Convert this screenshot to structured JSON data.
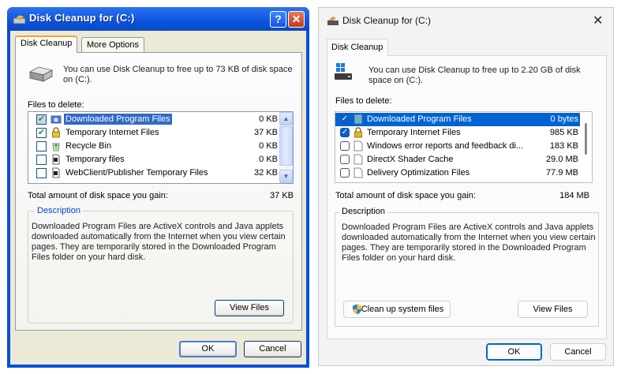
{
  "xp": {
    "title": "Disk Cleanup for  (C:)",
    "help_glyph": "?",
    "close_glyph": "✕",
    "tabs": [
      {
        "label": "Disk Cleanup"
      },
      {
        "label": "More Options"
      }
    ],
    "intro": "You can use Disk Cleanup to free up to 73 KB of disk space on  (C:).",
    "files_label": "Files to delete:",
    "files": [
      {
        "name": "Downloaded Program Files",
        "size": "0 KB",
        "checked": true,
        "icon": "folder-icon"
      },
      {
        "name": "Temporary Internet Files",
        "size": "37 KB",
        "checked": true,
        "icon": "lock-icon"
      },
      {
        "name": "Recycle Bin",
        "size": "0 KB",
        "checked": false,
        "icon": "recycle-bin-icon"
      },
      {
        "name": "Temporary files",
        "size": "0 KB",
        "checked": false,
        "icon": "file-icon"
      },
      {
        "name": "WebClient/Publisher Temporary Files",
        "size": "32 KB",
        "checked": false,
        "icon": "file-icon"
      }
    ],
    "check_glyph": "✔",
    "scroll_up": "▲",
    "scroll_down": "▼",
    "total_label": "Total amount of disk space you gain:",
    "total_value": "37 KB",
    "description_label": "Description",
    "description": "Downloaded Program Files are ActiveX controls and Java applets downloaded automatically from the Internet when you view certain pages. They are temporarily stored in the Downloaded Program Files folder on your hard disk.",
    "view_files": "View Files",
    "ok": "OK",
    "cancel": "Cancel"
  },
  "w11": {
    "title": "Disk Cleanup for  (C:)",
    "close_glyph": "✕",
    "tab": "Disk Cleanup",
    "intro": "You can use Disk Cleanup to free up to 2.20 GB of disk space on  (C:).",
    "files_label": "Files to delete:",
    "files": [
      {
        "name": "Downloaded Program Files",
        "size": "0 bytes",
        "checked": true,
        "icon": "folder-icon"
      },
      {
        "name": "Temporary Internet Files",
        "size": "985 KB",
        "checked": true,
        "icon": "lock-icon"
      },
      {
        "name": "Windows error reports and feedback di...",
        "size": "183 KB",
        "checked": false,
        "icon": "file-icon"
      },
      {
        "name": "DirectX Shader Cache",
        "size": "29.0 MB",
        "checked": false,
        "icon": "file-icon"
      },
      {
        "name": "Delivery Optimization Files",
        "size": "77.9 MB",
        "checked": false,
        "icon": "file-icon"
      }
    ],
    "check_glyph": "✓",
    "total_label": "Total amount of disk space you gain:",
    "total_value": "184 MB",
    "description_label": "Description",
    "description": "Downloaded Program Files are ActiveX controls and Java applets downloaded automatically from the Internet when you view certain pages. They are temporarily stored in the Downloaded Program Files folder on your hard disk.",
    "cleanup_system": "Clean up system files",
    "view_files": "View Files",
    "ok": "OK",
    "cancel": "Cancel"
  }
}
